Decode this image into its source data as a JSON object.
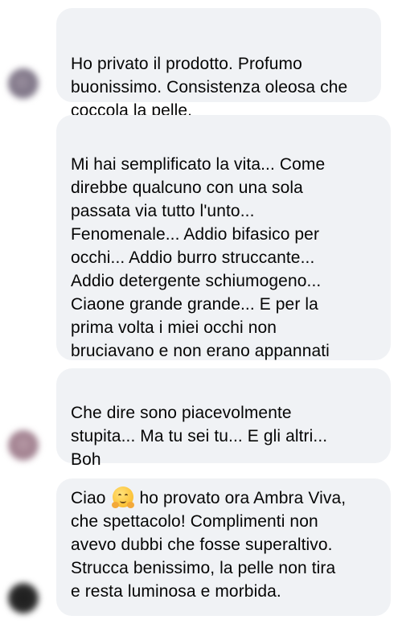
{
  "comments": [
    {
      "text": "Ho privato il prodotto. Profumo\nbuonissimo. Consistenza oleosa che\ncoccola la pelle."
    },
    {
      "text": "Mi hai semplificato la vita... Come\ndirebbe qualcuno con una sola\npassata via tutto l'unto...\nFenomenale... Addio bifasico per\nocchi... Addio burro struccante...\nAddio detergente schiumogeno...\nCiaone grande grande... E per la\nprima volta i miei occhi non\nbruciavano e non erano appannati"
    },
    {
      "text": "Che dire sono piacevolmente\nstupita... Ma tu sei tu... E gli altri...\nBoh"
    },
    {
      "text_before_emoji": "Ciao",
      "emoji": "hugging-face-emoji",
      "text_after_emoji": "ho provato ora Ambra Viva,\nche spettacolo! Complimenti non\navevo dubbi che fosse superaltivo.\nStrucca benissimo, la pelle non tira\ne resta luminosa e morbida."
    }
  ],
  "avatar_colors": [
    "#7d7486",
    "#a07f8e",
    "#2b2b2b"
  ],
  "bubble_color": "#f0f2f5"
}
